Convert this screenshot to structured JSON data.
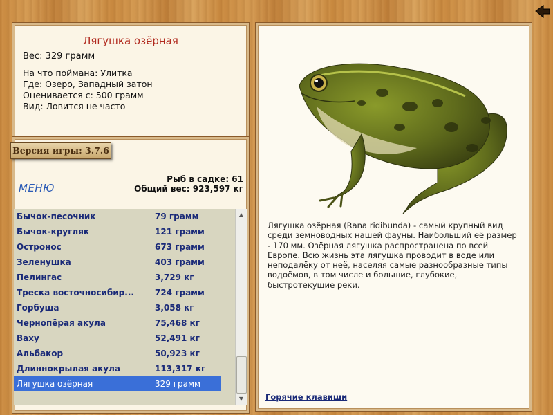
{
  "fish": {
    "name": "Лягушка озёрная",
    "weight": "Вес: 329 грамм",
    "bait": "На что поймана: Улитка",
    "location": "Где: Озеро, Западный затон",
    "appraised": "Оценивается с: 500 грамм",
    "rarity": "Вид: Ловится не часто"
  },
  "version": "Версия игры: 3.7.6",
  "menu_label": "МЕНЮ",
  "stats": {
    "fish_in_keepnet": "Рыб в садке: 61",
    "total_weight": "Общий вес: 923,597 кг"
  },
  "catch_list": [
    {
      "name": "Бычок-песочник",
      "weight": "79 грамм"
    },
    {
      "name": "Бычок-кругляк",
      "weight": "121 грамм"
    },
    {
      "name": "Остронос",
      "weight": "673 грамм"
    },
    {
      "name": "Зеленушка",
      "weight": "403 грамм"
    },
    {
      "name": "Пелингас",
      "weight": "3,729 кг"
    },
    {
      "name": "Треска восточносибир...",
      "weight": "724 грамм"
    },
    {
      "name": "Горбуша",
      "weight": "3,058 кг"
    },
    {
      "name": "Чернопёрая акула",
      "weight": "75,468 кг"
    },
    {
      "name": "Ваху",
      "weight": "52,491 кг"
    },
    {
      "name": "Альбакор",
      "weight": "50,923 кг"
    },
    {
      "name": "Длиннокрылая акула",
      "weight": "113,317 кг"
    },
    {
      "name": "Лягушка озёрная",
      "weight": "329 грамм"
    }
  ],
  "selected_index": 11,
  "description": "Лягушка озёрная (Rana ridibunda) - самый крупный вид среди земноводных нашей фауны. Наибольший её размер - 170 мм. Озёрная лягушка распространена по всей Европе. Всю жизнь эта лягушка проводит в воде или неподалёку от неё, населяя самые разнообразные типы водоёмов, в том числе и большие, глубокие, быстротекущие реки.",
  "hotkeys_label": "Горячие клавиши",
  "icons": {
    "back": "back-arrow-icon",
    "scroll_up": "scroll-up-arrow-icon",
    "scroll_down": "scroll-down-arrow-icon",
    "creature_image": "frog-image"
  },
  "colors": {
    "title": "#b12a1f",
    "list_text": "#1a2a78",
    "selected_row": "#3a6fd8",
    "menu_link": "#2a5ab5"
  }
}
